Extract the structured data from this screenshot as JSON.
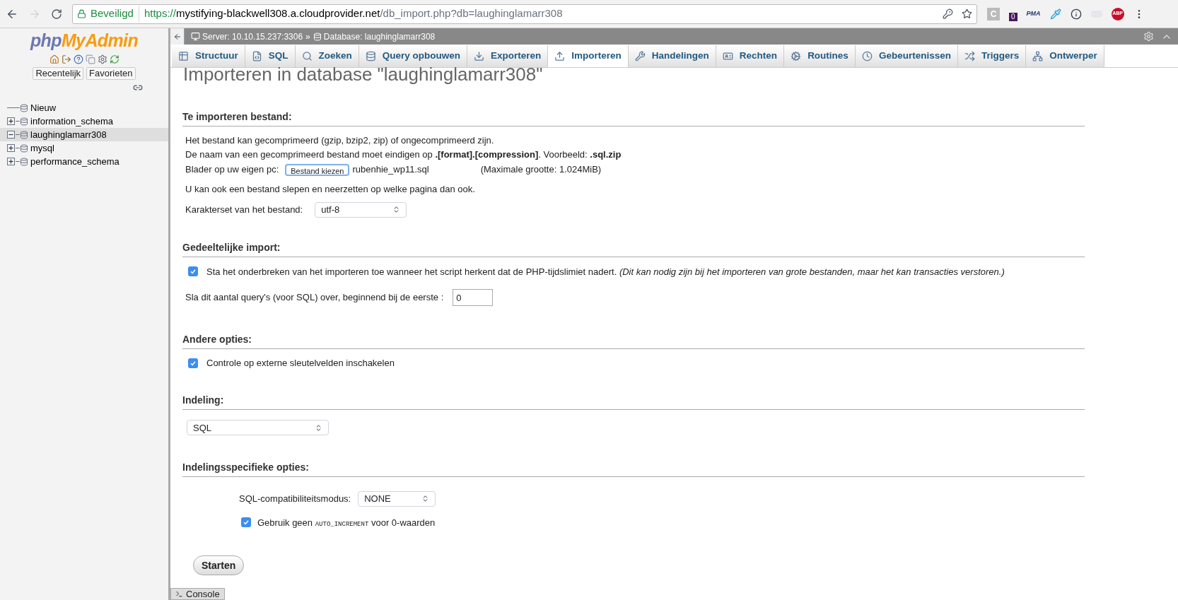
{
  "browser": {
    "secure_label": "Beveiligd",
    "url_scheme": "https://",
    "url_host": "mystifying-blackwell308.a.cloudprovider.net",
    "url_path": "/db_import.php?db=laughinglamarr308",
    "extensions": [
      {
        "kind": "letter",
        "text": "C"
      },
      {
        "kind": "badge",
        "text": "0"
      },
      {
        "kind": "pma",
        "text": "PMA"
      },
      {
        "kind": "dropper"
      },
      {
        "kind": "info"
      },
      {
        "kind": "blank"
      },
      {
        "kind": "abp",
        "text": "ABP"
      }
    ]
  },
  "sidebar": {
    "logo_php": "php",
    "logo_myadmin": "MyAdmin",
    "buttons": [
      "Recentelijk",
      "Favorieten"
    ],
    "tree": [
      {
        "label": "Nieuw",
        "kind": "new",
        "selected": false
      },
      {
        "label": "information_schema",
        "kind": "db",
        "expanded": false,
        "selected": false
      },
      {
        "label": "laughinglamarr308",
        "kind": "db",
        "expanded": true,
        "selected": true
      },
      {
        "label": "mysql",
        "kind": "db",
        "expanded": false,
        "selected": false
      },
      {
        "label": "performance_schema",
        "kind": "db",
        "expanded": false,
        "selected": false
      }
    ]
  },
  "breadcrumb": {
    "server": "Server: 10.10.15.237:3306",
    "separator": "»",
    "database": "Database: laughinglamarr308"
  },
  "tabs": [
    {
      "label": "Structuur",
      "selected": false
    },
    {
      "label": "SQL",
      "selected": false
    },
    {
      "label": "Zoeken",
      "selected": false
    },
    {
      "label": "Query opbouwen",
      "selected": false
    },
    {
      "label": "Exporteren",
      "selected": false
    },
    {
      "label": "Importeren",
      "selected": true
    },
    {
      "label": "Handelingen",
      "selected": false
    },
    {
      "label": "Rechten",
      "selected": false
    },
    {
      "label": "Routines",
      "selected": false
    },
    {
      "label": "Gebeurtenissen",
      "selected": false
    },
    {
      "label": "Triggers",
      "selected": false
    },
    {
      "label": "Ontwerper",
      "selected": false
    }
  ],
  "title": "Importeren in database \"laughinglamarr308\"",
  "file_section": {
    "heading": "Te importeren bestand:",
    "line1": "Het bestand kan gecomprimeerd (gzip, bzip2, zip) of ongecomprimeerd zijn.",
    "line2": "De naam van een gecomprimeerd bestand moet eindigen op **.[format].[compression]**. Voorbeeld: **.sql.zip**",
    "browse_label": "Blader op uw eigen pc:",
    "browse_button": "Bestand kiezen",
    "file_name": "rubenhie_wp11.sql",
    "max_size": "(Maximale grootte: 1.024MiB)",
    "drag_hint": "U kan ook een bestand slepen en neerzetten op welke pagina dan ook.",
    "charset_label": "Karakterset van het bestand:",
    "charset_value": "utf-8"
  },
  "partial_section": {
    "heading": "Gedeeltelijke import:",
    "interrupt_label": "Sta het onderbreken van het importeren toe wanneer het script herkent dat de PHP-tijdslimiet nadert.",
    "interrupt_note": "(Dit kan nodig zijn bij het importeren van grote bestanden, maar het kan transacties verstoren.)",
    "interrupt_checked": true,
    "skip_label": "Sla dit aantal query's (voor SQL) over, beginnend bij de eerste :",
    "skip_value": "0"
  },
  "other_section": {
    "heading": "Andere opties:",
    "fk_label": "Controle op externe sleutelvelden inschakelen",
    "fk_checked": true
  },
  "format_section": {
    "heading": "Indeling:",
    "format_value": "SQL"
  },
  "specific_section": {
    "heading": "Indelingsspecifieke opties:",
    "compat_label": "SQL-compatibiliteitsmodus:",
    "compat_value": "NONE",
    "auto_label_before": "Gebruik geen",
    "auto_code": "AUTO_INCREMENT",
    "auto_label_after": "voor 0-waarden",
    "auto_checked": true
  },
  "submit": "Starten",
  "console": "Console"
}
